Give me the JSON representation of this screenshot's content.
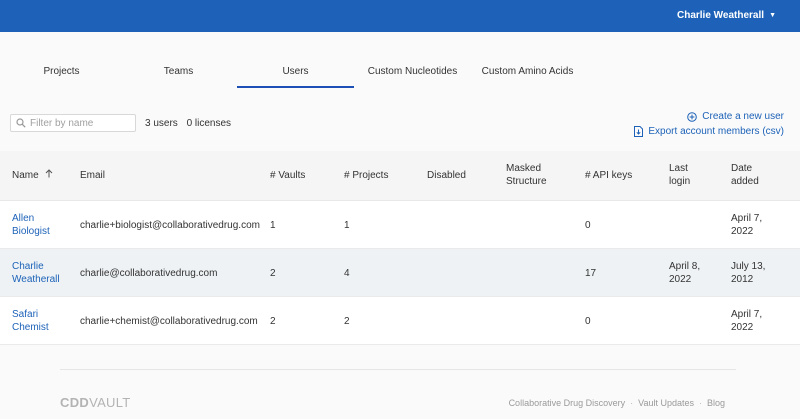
{
  "header": {
    "user_name": "Charlie Weatherall",
    "brand_color": "#1d62b8"
  },
  "tabs": [
    {
      "label": "Projects",
      "active": false
    },
    {
      "label": "Teams",
      "active": false
    },
    {
      "label": "Users",
      "active": true
    },
    {
      "label": "Custom Nucleotides",
      "active": false
    },
    {
      "label": "Custom Amino Acids",
      "active": false
    }
  ],
  "filter": {
    "placeholder": "Filter by name",
    "value": ""
  },
  "counts": {
    "users": "3 users",
    "licenses": "0 licenses"
  },
  "actions": {
    "create_user": "Create a new user",
    "export_csv": "Export account members (csv)"
  },
  "table": {
    "headers": {
      "name": "Name",
      "email": "Email",
      "vaults": "# Vaults",
      "projects": "# Projects",
      "disabled": "Disabled",
      "masked_1": "Masked",
      "masked_2": "Structure",
      "api_keys": "# API keys",
      "last_1": "Last",
      "last_2": "login",
      "date_1": "Date",
      "date_2": "added"
    },
    "sort": {
      "column": "Name",
      "direction": "ascending"
    },
    "rows": [
      {
        "name_1": "Allen",
        "name_2": "Biologist",
        "email": "charlie+biologist@collaborativedrug.com",
        "vaults": "1",
        "projects": "1",
        "disabled": "",
        "masked": "",
        "api_keys": "0",
        "last_1": "",
        "last_2": "",
        "date_1": "April 7,",
        "date_2": "2022"
      },
      {
        "name_1": "Charlie",
        "name_2": "Weatherall",
        "email": "charlie@collaborativedrug.com",
        "vaults": "2",
        "projects": "4",
        "disabled": "",
        "masked": "",
        "api_keys": "17",
        "last_1": "April 8,",
        "last_2": "2022",
        "date_1": "July 13,",
        "date_2": "2012"
      },
      {
        "name_1": "Safari",
        "name_2": "Chemist",
        "email": "charlie+chemist@collaborativedrug.com",
        "vaults": "2",
        "projects": "2",
        "disabled": "",
        "masked": "",
        "api_keys": "0",
        "last_1": "",
        "last_2": "",
        "date_1": "April 7,",
        "date_2": "2022"
      }
    ]
  },
  "footer": {
    "logo_bold": "CDD",
    "logo_thin": "VAULT",
    "links": [
      "Collaborative Drug Discovery",
      "Vault Updates",
      "Blog"
    ],
    "separator": "·"
  }
}
